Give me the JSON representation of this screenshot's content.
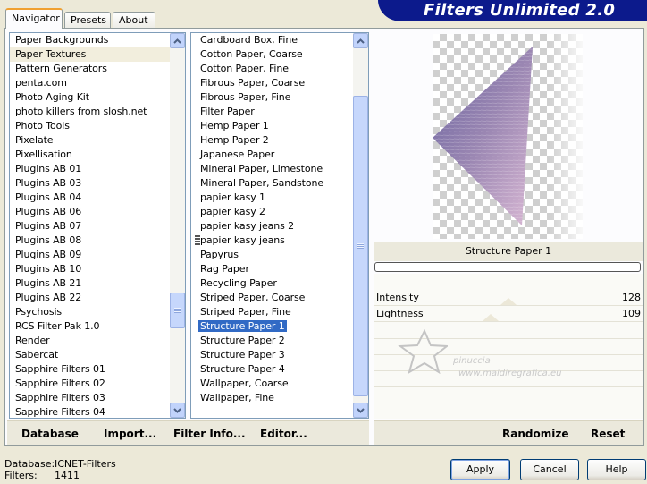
{
  "app": {
    "title": "Filters Unlimited 2.0"
  },
  "tabs": [
    {
      "label": "Navigator"
    },
    {
      "label": "Presets"
    },
    {
      "label": "About"
    }
  ],
  "categories": {
    "items": [
      "Paper Backgrounds",
      "Paper Textures",
      "Pattern Generators",
      "penta.com",
      "Photo Aging Kit",
      "photo killers from slosh.net",
      "Photo Tools",
      "Pixelate",
      "Pixellisation",
      "Plugins AB 01",
      "Plugins AB 03",
      "Plugins AB 04",
      "Plugins AB 06",
      "Plugins AB 07",
      "Plugins AB 08",
      "Plugins AB 09",
      "Plugins AB 10",
      "Plugins AB 21",
      "Plugins AB 22",
      "Psychosis",
      "RCS Filter Pak 1.0",
      "Render",
      "Sabercat",
      "Sapphire Filters 01",
      "Sapphire Filters 02",
      "Sapphire Filters 03",
      "Sapphire Filters 04"
    ],
    "highlighted": "Paper Textures"
  },
  "filters": {
    "items": [
      "Cardboard Box, Fine",
      "Cotton Paper, Coarse",
      "Cotton Paper, Fine",
      "Fibrous Paper, Coarse",
      "Fibrous Paper, Fine",
      "Filter Paper",
      "Hemp Paper 1",
      "Hemp Paper 2",
      "Japanese Paper",
      "Mineral Paper, Limestone",
      "Mineral Paper, Sandstone",
      "papier kasy 1",
      "papier kasy 2",
      "papier kasy jeans 2",
      "papier kasy jeans",
      "Papyrus",
      "Rag Paper",
      "Recycling Paper",
      "Striped Paper, Coarse",
      "Striped Paper, Fine",
      "Structure Paper 1",
      "Structure Paper 2",
      "Structure Paper 3",
      "Structure Paper 4",
      "Wallpaper, Coarse",
      "Wallpaper, Fine"
    ],
    "selected": "Structure Paper 1"
  },
  "preview": {
    "filter_name": "Structure Paper 1"
  },
  "params": [
    {
      "label": "Intensity",
      "value": "128",
      "level": 0.5
    },
    {
      "label": "Lightness",
      "value": "109",
      "level": 0.43
    }
  ],
  "watermark": {
    "line1": "pinuccia",
    "line2": "www.maidiregrafica.eu"
  },
  "left_commands": {
    "database": "Database",
    "import": "Import...",
    "filter_info": "Filter Info...",
    "editor": "Editor..."
  },
  "right_commands": {
    "randomize": "Randomize",
    "reset": "Reset"
  },
  "status": {
    "db_label": "Database:",
    "db_value": "ICNET-Filters",
    "filters_label": "Filters:",
    "filters_value": "1411"
  },
  "buttons": {
    "apply": "Apply",
    "cancel": "Cancel",
    "help": "Help"
  },
  "icons": {
    "scroll_up": "chevron-up-icon",
    "scroll_down": "chevron-down-icon"
  }
}
